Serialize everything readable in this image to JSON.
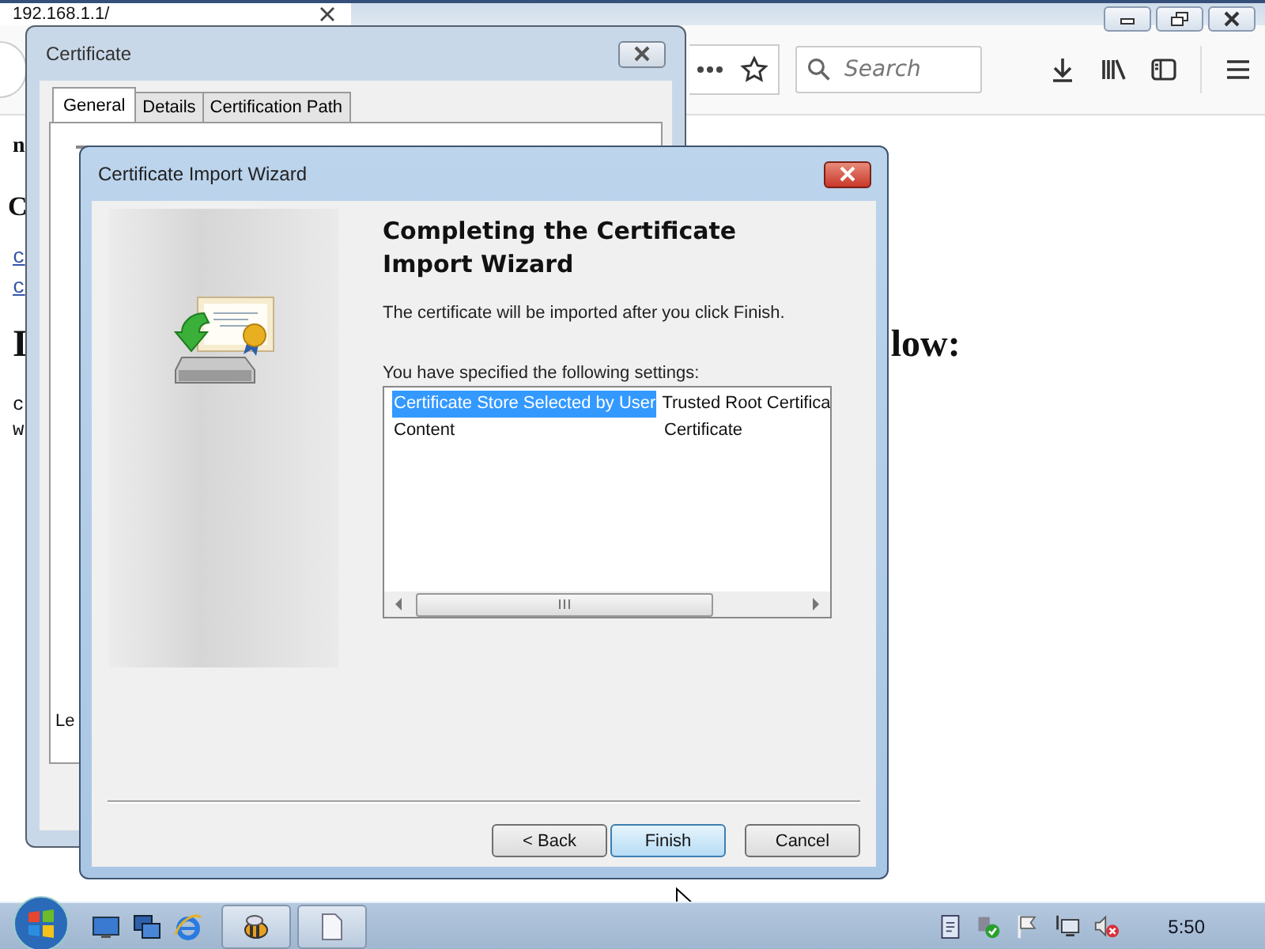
{
  "browser": {
    "tab": {
      "title": "192.168.1.1/"
    },
    "search": {
      "placeholder": "Search"
    },
    "page_fragments": [
      {
        "kind": "bold",
        "text": "n"
      },
      {
        "kind": "heading",
        "text": "C"
      },
      {
        "kind": "link",
        "text": "c"
      },
      {
        "kind": "link",
        "text": "c"
      },
      {
        "kind": "big",
        "text": "I",
        "tail": "low:"
      },
      {
        "kind": "mono",
        "text": "c"
      },
      {
        "kind": "mono",
        "text": "w"
      }
    ]
  },
  "certificate_window": {
    "title": "Certificate",
    "tabs": [
      {
        "label": "General",
        "selected": true
      },
      {
        "label": "Details",
        "selected": false
      },
      {
        "label": "Certification Path",
        "selected": false
      }
    ],
    "body_fragment": "Le"
  },
  "wizard": {
    "title": "Certificate Import Wizard",
    "heading": "Completing the Certificate Import Wizard",
    "message": "The certificate will be imported after you click Finish.",
    "settings_label": "You have specified the following settings:",
    "settings": [
      {
        "name": "Certificate Store Selected by User",
        "value": "Trusted Root Certifica",
        "selected": true
      },
      {
        "name": "Content",
        "value": "Certificate",
        "selected": false
      }
    ],
    "buttons": [
      {
        "label": "< Back",
        "focused": false
      },
      {
        "label": "Finish",
        "focused": true
      },
      {
        "label": "Cancel",
        "focused": false
      }
    ]
  },
  "taskbar": {
    "clock": "5:50"
  }
}
